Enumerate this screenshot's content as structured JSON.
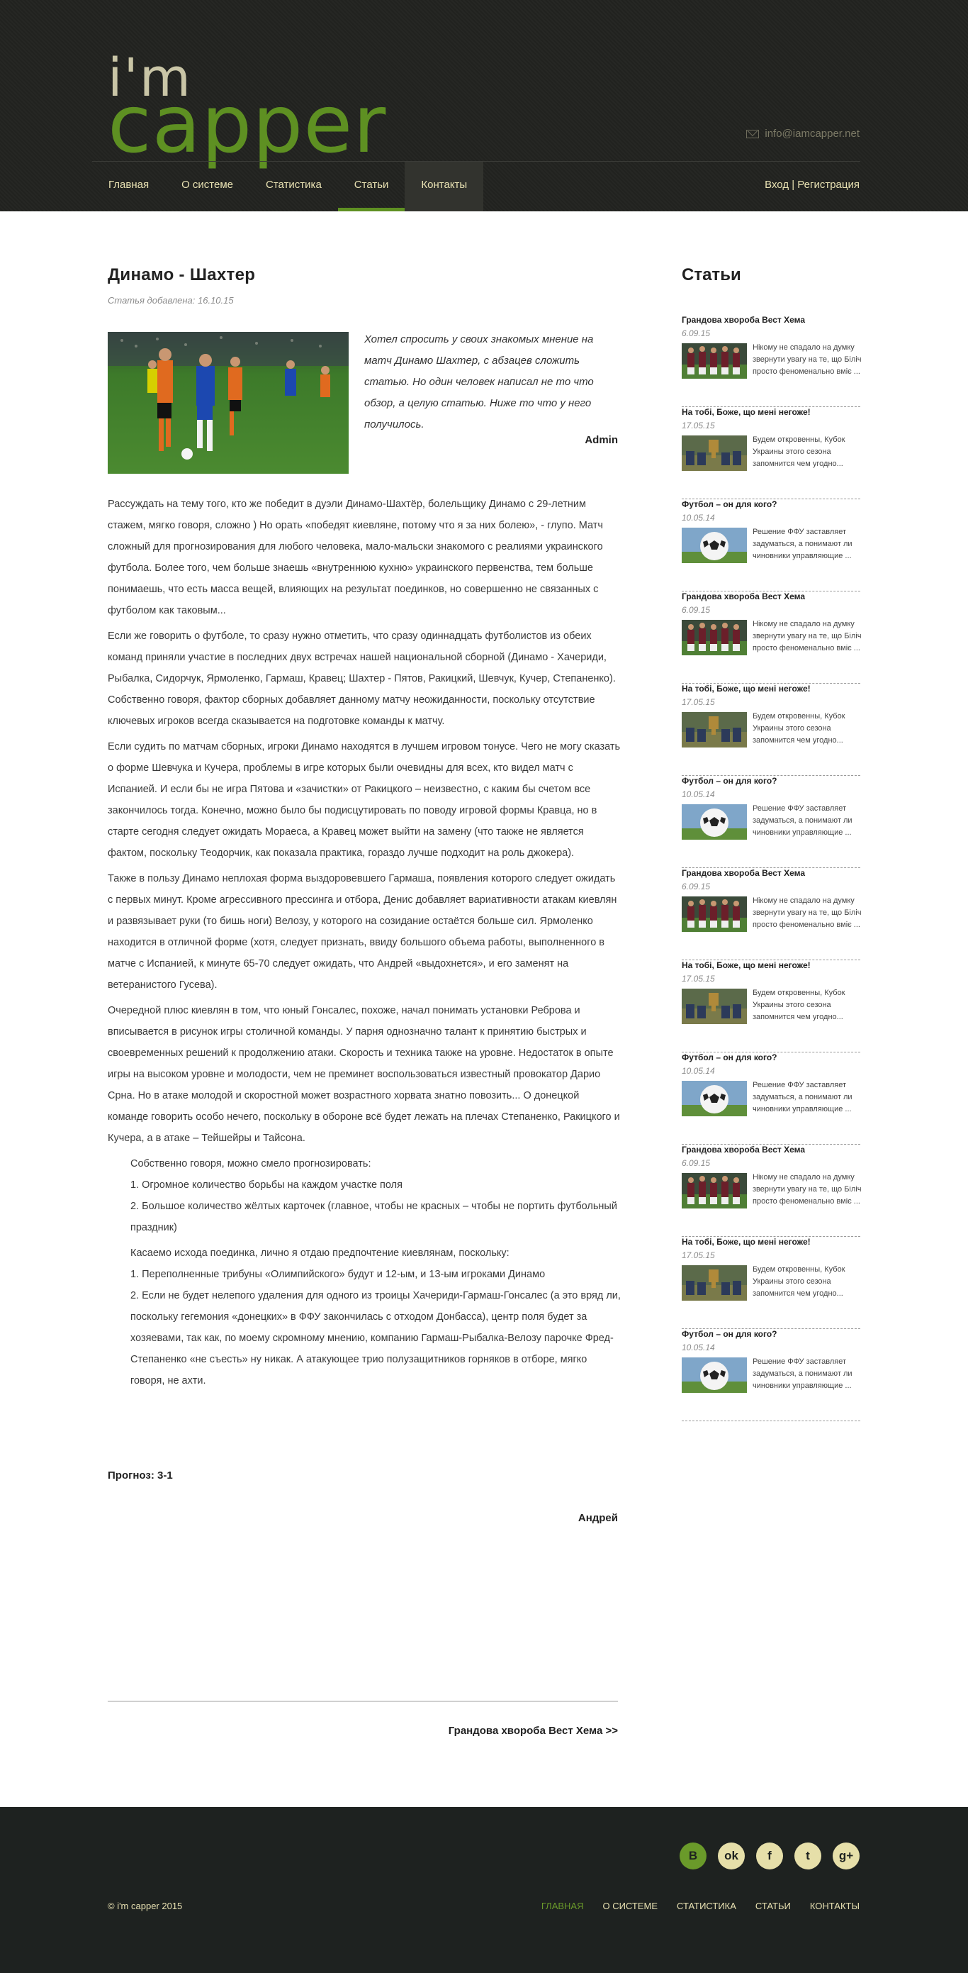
{
  "header": {
    "logo_top": "i'm",
    "logo_bottom": "capper",
    "email": "info@iamcapper.net",
    "nav": [
      "Главная",
      "О системе",
      "Статистика",
      "Статьи",
      "Контакты"
    ],
    "login": "Вход | Регистрация"
  },
  "article": {
    "title": "Динамо - Шахтер",
    "added": "Статья добавлена: 16.10.15",
    "intro": "Хотел спросить у своих знакомых мнение на матч Динамо Шахтер, с абзацев сложить статью. Но один человек написал не то что обзор, а целую статью. Ниже то что у него получилось.",
    "intro_author": "Admin",
    "paragraphs": [
      "Рассуждать на тему того, кто же победит в дуэли Динамо-Шахтёр, болельщику Динамо с 29-летним стажем, мягко говоря, сложно ) Но орать «победят киевляне, потому что я за них болею», - глупо. Матч сложный для прогнозирования для любого человека, мало-мальски знакомого с реалиями украинского футбола. Более того, чем больше знаешь «внутреннюю кухню» украинского первенства, тем больше понимаешь, что есть масса вещей, влияющих на результат поединков, но совершенно не связанных с футболом как таковым...",
      "Если же говорить о футболе, то сразу нужно отметить, что сразу одиннадцать футболистов из обеих команд приняли участие в последних двух встречах нашей национальной сборной (Динамо - Хачериди, Рыбалка, Сидорчук, Ярмоленко, Гармаш, Кравец; Шахтер - Пятов, Ракицкий, Шевчук, Кучер, Степаненко). Собственно говоря, фактор сборных добавляет данному матчу неожиданности, поскольку отсутствие ключевых игроков всегда сказывается на подготовке команды к матчу.",
      "Если судить по матчам сборных, игроки Динамо находятся в лучшем игровом тонусе. Чего не могу сказать о форме Шевчука и Кучера, проблемы в игре которых были очевидны для всех, кто видел матч с Испанией. И если бы не игра Пятова и «зачистки» от Ракицкого – неизвестно, с каким бы счетом все закончилось тогда. Конечно, можно было бы подисцутировать по поводу игровой формы Кравца, но в старте сегодня следует ожидать Мораеса, а Кравец может выйти на замену (что также не является фактом, поскольку Теодорчик, как показала практика, гораздо лучше подходит на роль джокера).",
      "Также в пользу Динамо неплохая форма выздоровевшего Гармаша, появления которого следует ожидать с первых минут. Кроме агрессивного прессинга и отбора, Денис добавляет вариативности атакам киевлян и развязывает руки (то бишь ноги) Велозу, у которого на созидание остаётся больше сил. Ярмоленко находится в отличной форме (хотя, следует признать, ввиду большого объема работы, выполненного в матче с Испанией, к минуте 65-70 следует ожидать, что Андрей «выдохнется», и его заменят на ветеранистого Гусева).",
      "Очередной плюс киевлян в том, что юный Гонсалес, похоже, начал понимать установки Реброва и вписывается в рисунок игры столичной команды. У парня однозначно талант к принятию быстрых и своевременных решений к продолжению атаки. Скорость и техника также на уровне. Недостаток в опыте игры на высоком уровне и молодости, чем не преминет воспользоваться известный провокатор Дарио Срна. Но в атаке молодой и скоростной может возрастного хорвата знатно повозить... О донецкой команде говорить особо нечего, поскольку в обороне всё будет лежать на плечах Степаненко, Ракицкого и Кучера, а в атаке – Тейшейры и Тайсона."
    ],
    "list1_intro": "Собственно говоря, можно смело прогнозировать:",
    "list1": [
      "1. Огромное количество борьбы на каждом участке поля",
      "2. Большое количество жёлтых карточек (главное, чтобы не красных – чтобы не портить футбольный праздник)"
    ],
    "list2_intro": "Касаемо исхода поединка, лично я отдаю предпочтение киевлянам, поскольку:",
    "list2": [
      "1. Переполненные трибуны «Олимпийского» будут и 12-ым, и 13-ым игроками Динамо",
      "2. Если не будет нелепого удаления для одного из троицы Хачериди-Гармаш-Гонсалес (а это вряд ли, поскольку гегемония «донецких» в ФФУ закончилась с отходом Донбасса), центр поля будет за хозяевами, так как, по моему скромному мнению, компанию Гармаш-Рыбалка-Велозу парочке Фред-Степаненко «не съесть» ну никак. А атакующее трио полузащитников горняков в отборе, мягко говоря, не ахти."
    ],
    "prognoz": "Прогноз: 3-1",
    "author": "Андрей",
    "next_link": "Грандова хвороба Вест Хема >>"
  },
  "sidebar": {
    "title": "Статьи",
    "items": [
      {
        "title": "Грандова хвороба Вест Хема",
        "date": "6.09.15",
        "text": "Нікому не спадало на думку звернути увагу на те, що Біліч просто феноменально вміє ...",
        "thumb": "team"
      },
      {
        "title": "На тобі, Боже, що мені негоже!",
        "date": "17.05.15",
        "text": "Будем откровенны, Кубок Украины этого сезона запомнится чем угодно...",
        "thumb": "cup"
      },
      {
        "title": "Футбол – он для кого?",
        "date": "10.05.14",
        "text": "Решение ФФУ заставляет задуматься, а понимают ли чиновники управляющие ...",
        "thumb": "ball"
      },
      {
        "title": "Грандова хвороба Вест Хема",
        "date": "6.09.15",
        "text": "Нікому не спадало на думку звернути увагу на те, що Біліч просто феноменально вміє ...",
        "thumb": "team"
      },
      {
        "title": "На тобі, Боже, що мені негоже!",
        "date": "17.05.15",
        "text": "Будем откровенны, Кубок Украины этого сезона запомнится чем угодно...",
        "thumb": "cup"
      },
      {
        "title": "Футбол – он для кого?",
        "date": "10.05.14",
        "text": "Решение ФФУ заставляет задуматься, а понимают ли чиновники управляющие ...",
        "thumb": "ball"
      },
      {
        "title": "Грандова хвороба Вест Хема",
        "date": "6.09.15",
        "text": "Нікому не спадало на думку звернути увагу на те, що Біліч просто феноменально вміє ...",
        "thumb": "team"
      },
      {
        "title": "На тобі, Боже, що мені негоже!",
        "date": "17.05.15",
        "text": "Будем откровенны, Кубок Украины этого сезона запомнится чем угодно...",
        "thumb": "cup"
      },
      {
        "title": "Футбол – он для кого?",
        "date": "10.05.14",
        "text": "Решение ФФУ заставляет задуматься, а понимают ли чиновники управляющие ...",
        "thumb": "ball"
      },
      {
        "title": "Грандова хвороба Вест Хема",
        "date": "6.09.15",
        "text": "Нікому не спадало на думку звернути увагу на те, що Біліч просто феноменально вміє ...",
        "thumb": "team"
      },
      {
        "title": "На тобі, Боже, що мені негоже!",
        "date": "17.05.15",
        "text": "Будем откровенны, Кубок Украины этого сезона запомнится чем угодно...",
        "thumb": "cup"
      },
      {
        "title": "Футбол – он для кого?",
        "date": "10.05.14",
        "text": "Решение ФФУ заставляет задуматься, а понимают ли чиновники управляющие ...",
        "thumb": "ball"
      }
    ]
  },
  "footer": {
    "socials": [
      {
        "icon": "vk-icon",
        "glyph": "В"
      },
      {
        "icon": "odnoklassniki-icon",
        "glyph": "ok"
      },
      {
        "icon": "facebook-icon",
        "glyph": "f"
      },
      {
        "icon": "twitter-icon",
        "glyph": "t"
      },
      {
        "icon": "google-plus-icon",
        "glyph": "g+"
      }
    ],
    "copyright": "© i'm capper 2015",
    "nav": [
      "Главная",
      "О системе",
      "Статистика",
      "Статьи",
      "Контакты"
    ]
  },
  "colors": {
    "accent": "#5e9022",
    "nav_text": "#e8e1b2",
    "header_bg": "#222320",
    "footer_bg": "#1e2220"
  }
}
